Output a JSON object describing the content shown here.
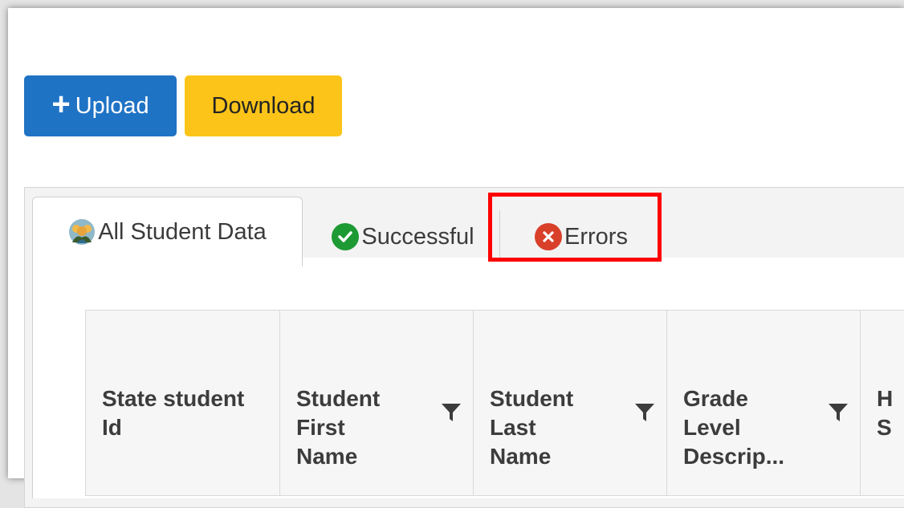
{
  "toolbar": {
    "upload_label": "Upload",
    "download_label": "Download",
    "upload_color": "#1f73c5",
    "download_color": "#fcc419"
  },
  "tabs": [
    {
      "label": "All Student Data",
      "icon": "student-group-icon",
      "active": true
    },
    {
      "label": "Successful",
      "icon": "check-circle-icon",
      "active": false
    },
    {
      "label": "Errors",
      "icon": "error-x-circle-icon",
      "active": false,
      "highlighted": true
    }
  ],
  "grid": {
    "columns": [
      {
        "label": "State student Id",
        "filterable": false
      },
      {
        "label": "Student First Name",
        "filterable": true
      },
      {
        "label": "Student Last Name",
        "filterable": true
      },
      {
        "label": "Grade Level Descrip...",
        "filterable": true
      },
      {
        "label": "H S",
        "filterable": false
      }
    ]
  },
  "colors": {
    "highlight_box": "#ff0000",
    "success": "#1e9a34",
    "error": "#d9402a"
  }
}
